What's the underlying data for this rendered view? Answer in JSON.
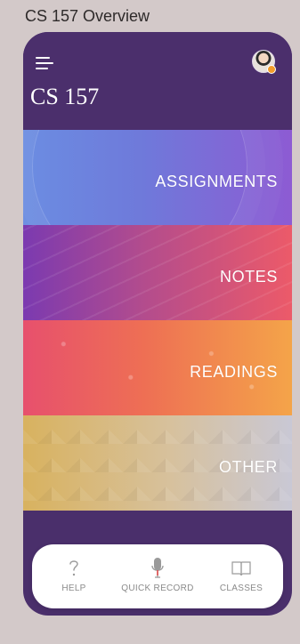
{
  "window_title": "CS 157 Overview",
  "course": {
    "title": "CS 157"
  },
  "header": {
    "menu_icon": "hamburger-menu-icon",
    "avatar_icon": "user-avatar-icon"
  },
  "tiles": [
    {
      "label": "ASSIGNMENTS",
      "colors": [
        "#6b8de2",
        "#8d5bd3"
      ]
    },
    {
      "label": "NOTES",
      "colors": [
        "#7b3ab0",
        "#ec5a69"
      ]
    },
    {
      "label": "READINGS",
      "colors": [
        "#e7506d",
        "#f4a449"
      ]
    },
    {
      "label": "OTHER",
      "colors": [
        "#d8b25f",
        "#c9c8d5"
      ]
    }
  ],
  "bottom_nav": [
    {
      "label": "HELP",
      "icon": "question-mark-icon"
    },
    {
      "label": "QUICK RECORD",
      "icon": "microphone-icon"
    },
    {
      "label": "CLASSES",
      "icon": "book-icon"
    }
  ],
  "colors": {
    "header_bg": "#4b2f6c",
    "nav_bg": "#ffffff",
    "nav_text": "#8a8a8a"
  }
}
